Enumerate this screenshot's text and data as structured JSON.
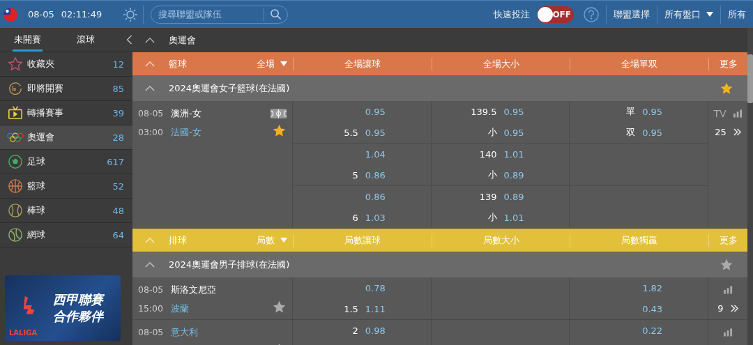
{
  "topbar": {
    "date": "08-05",
    "time": "02:11:49",
    "search": {
      "placeholder": "搜尋聯盟或隊伍"
    },
    "quick_bet": {
      "label": "快速投注",
      "on": false,
      "state_text": "OFF"
    },
    "menus": [
      {
        "label": "聯盟選擇",
        "dropdown": false
      },
      {
        "label": "所有盤口",
        "dropdown": true
      },
      {
        "label": "所有",
        "dropdown": false
      }
    ]
  },
  "sidebar": {
    "tabs": [
      {
        "label": "未開賽",
        "selected": true
      },
      {
        "label": "滾球",
        "selected": false
      }
    ],
    "items": [
      {
        "kind": "favorites",
        "label": "收藏夾",
        "count": "12",
        "selected": false
      },
      {
        "kind": "soon",
        "label": "即將開賽",
        "count": "85",
        "selected": false
      },
      {
        "kind": "tv",
        "label": "轉播賽事",
        "count": "39",
        "selected": false
      },
      {
        "kind": "olympics",
        "label": "奧運會",
        "count": "28",
        "selected": true
      },
      {
        "kind": "soccer",
        "label": "足球",
        "count": "617",
        "selected": false
      },
      {
        "kind": "basketball",
        "label": "籃球",
        "count": "52",
        "selected": false
      },
      {
        "kind": "baseball",
        "label": "棒球",
        "count": "48",
        "selected": false
      },
      {
        "kind": "tennis",
        "label": "網球",
        "count": "64",
        "selected": false
      }
    ],
    "banner": {
      "logo": "LALIGA",
      "lines": [
        "西甲聯賽",
        "合作夥伴"
      ]
    }
  },
  "main": {
    "title": "奧運會",
    "sports": [
      {
        "name": "籃球",
        "color": "#d9774a",
        "period": "全場",
        "columns": [
          "全場讓球",
          "全場大小",
          "全場單双"
        ],
        "more": "更多",
        "leagues": [
          {
            "title": "2024奧運會女子籃球(在法國)",
            "favorite": true,
            "matches": [
              {
                "date": "08-05",
                "time": "03:00",
                "teams": [
                  {
                    "name": "澳洲-女",
                    "highlighted": false
                  },
                  {
                    "name": "法國-女",
                    "highlighted": true
                  }
                ],
                "favorite": true,
                "court": true,
                "tv_label": "TV",
                "count": "25",
                "lines": [
                  {
                    "handicap": {
                      "home": {
                        "odds": "0.95"
                      },
                      "away": {
                        "line": "5.5",
                        "odds": "0.95"
                      }
                    },
                    "total": {
                      "home": {
                        "line": "139.5",
                        "odds": "0.95"
                      },
                      "away": {
                        "line": "小",
                        "odds": "0.95"
                      }
                    },
                    "result": {
                      "home": {
                        "line": "單",
                        "odds": "0.95"
                      },
                      "away": {
                        "line": "双",
                        "odds": "0.95"
                      }
                    }
                  },
                  {
                    "handicap": {
                      "home": {
                        "odds": "1.04"
                      },
                      "away": {
                        "line": "5",
                        "odds": "0.86"
                      }
                    },
                    "total": {
                      "home": {
                        "line": "140",
                        "odds": "1.01"
                      },
                      "away": {
                        "line": "小",
                        "odds": "0.89"
                      }
                    }
                  },
                  {
                    "handicap": {
                      "home": {
                        "odds": "0.86"
                      },
                      "away": {
                        "line": "6",
                        "odds": "1.03"
                      }
                    },
                    "total": {
                      "home": {
                        "line": "139",
                        "odds": "0.89"
                      },
                      "away": {
                        "line": "小",
                        "odds": "1.01"
                      }
                    }
                  }
                ]
              }
            ]
          }
        ]
      },
      {
        "name": "排球",
        "color": "#e2c03a",
        "period": "局數",
        "columns": [
          "局數讓球",
          "局數大小",
          "局數獨贏"
        ],
        "more": "更多",
        "leagues": [
          {
            "title": "2024奧運會男子排球(在法國)",
            "favorite": false,
            "matches": [
              {
                "date": "08-05",
                "time": "15:00",
                "teams": [
                  {
                    "name": "斯洛文尼亞",
                    "highlighted": false
                  },
                  {
                    "name": "波蘭",
                    "highlighted": true
                  }
                ],
                "favorite": false,
                "count": "9",
                "lines": [
                  {
                    "handicap": {
                      "home": {
                        "odds": "0.78"
                      },
                      "away": {
                        "line": "1.5",
                        "odds": "1.11"
                      }
                    },
                    "result": {
                      "home": {
                        "odds": "1.82"
                      },
                      "away": {
                        "odds": "0.43"
                      }
                    }
                  }
                ]
              },
              {
                "date": "08-05",
                "teams": [
                  {
                    "name": "意大利",
                    "highlighted": true
                  }
                ],
                "favorite": false,
                "lines": [
                  {
                    "handicap": {
                      "home": {
                        "line": "2",
                        "odds": "0.98"
                      }
                    },
                    "result": {
                      "home": {
                        "odds": "0.22"
                      }
                    }
                  }
                ]
              }
            ]
          }
        ]
      }
    ]
  }
}
